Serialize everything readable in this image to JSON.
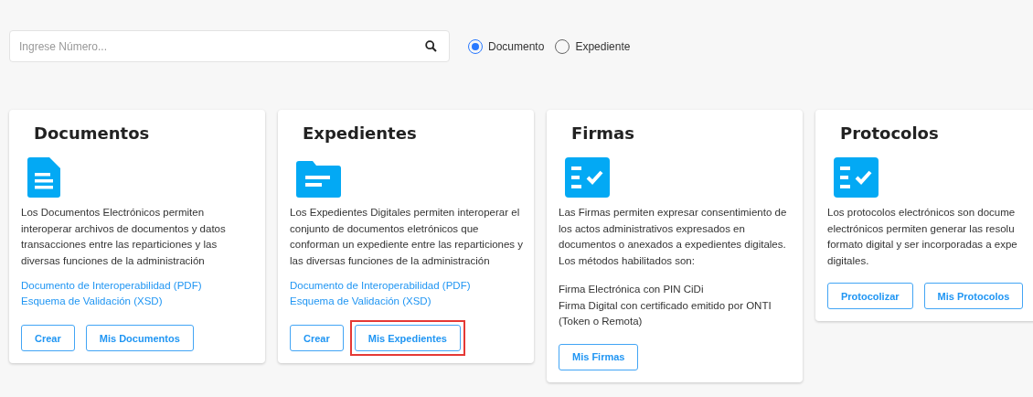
{
  "search": {
    "placeholder": "Ingrese Número..."
  },
  "search_type": [
    {
      "label": "Documento",
      "selected": true
    },
    {
      "label": "Expediente",
      "selected": false
    }
  ],
  "cards": [
    {
      "title": "Documentos",
      "kind": "document",
      "description_lines": [
        "Los Documentos Electrónicos permiten",
        "interoperar archivos de documentos y datos",
        "transacciones entre las reparticiones y las",
        "diversas funciones de la administración"
      ],
      "links": [
        "Documento de Interoperabilidad (PDF)",
        "Esquema de Validación (XSD)"
      ],
      "buttons": [
        {
          "label": "Crear",
          "highlighted": false
        },
        {
          "label": "Mis Documentos",
          "highlighted": false
        }
      ]
    },
    {
      "title": "Expedientes",
      "kind": "folder",
      "description_lines": [
        "Los Expedientes Digitales permiten interoperar el",
        "conjunto de documentos eletrónicos que",
        "conforman un expediente entre las reparticiones y",
        "las diversas funciones de la administración"
      ],
      "links": [
        "Documento de Interoperabilidad (PDF)",
        "Esquema de Validación (XSD)"
      ],
      "buttons": [
        {
          "label": "Crear",
          "highlighted": false
        },
        {
          "label": "Mis Expedientes",
          "highlighted": true
        }
      ]
    },
    {
      "title": "Firmas",
      "kind": "checklist",
      "description_lines": [
        "Las Firmas permiten expresar consentimiento de",
        "los actos administrativos expresados en",
        "documentos o anexados a expedientes digitales.",
        "Los métodos habilitados son:"
      ],
      "methods_lines": [
        "Firma Electrónica con PIN CiDi",
        "Firma Digital con certificado emitido por ONTI",
        "(Token o Remota)"
      ],
      "buttons": [
        {
          "label": "Mis Firmas",
          "highlighted": false
        }
      ]
    },
    {
      "title": "Protocolos",
      "kind": "checklist",
      "description_lines": [
        "Los protocolos electrónicos son docume",
        "electrónicos permiten generar las resolu",
        "formato digital y ser incorporadas a expe",
        "digitales."
      ],
      "buttons": [
        {
          "label": "Protocolizar",
          "highlighted": false
        },
        {
          "label": "Mis Protocolos",
          "highlighted": false
        }
      ]
    }
  ]
}
